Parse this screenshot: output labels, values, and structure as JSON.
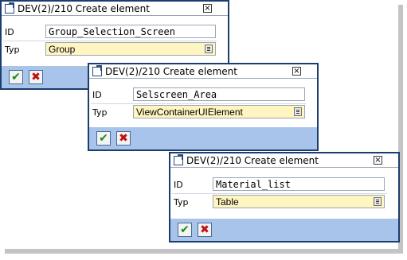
{
  "dialogs": [
    {
      "title": "DEV(2)/210 Create element",
      "close_glyph": "×",
      "id_label": "ID",
      "id_value": "Group_Selection_Screen",
      "typ_label": "Typ",
      "typ_value": "Group"
    },
    {
      "title": "DEV(2)/210 Create element",
      "close_glyph": "×",
      "id_label": "ID",
      "id_value": "Selscreen_Area",
      "typ_label": "Typ",
      "typ_value": "ViewContainerUIElement"
    },
    {
      "title": "DEV(2)/210 Create element",
      "close_glyph": "×",
      "id_label": "ID",
      "id_value": "Material_list",
      "typ_label": "Typ",
      "typ_value": "Table"
    }
  ],
  "buttons": {
    "ok_glyph": "✔",
    "cancel_glyph": "✖"
  },
  "icons": {
    "title": "external-window-icon",
    "dropdown": "dropdown-list-icon",
    "ok": "checkmark-icon",
    "cancel": "cross-icon"
  },
  "colors": {
    "frame_border": "#1c3e6e",
    "button_bar": "#a8c4ea",
    "typ_field": "#fff5c0",
    "ok_green": "#1a8a1a",
    "cancel_red": "#c01010"
  }
}
